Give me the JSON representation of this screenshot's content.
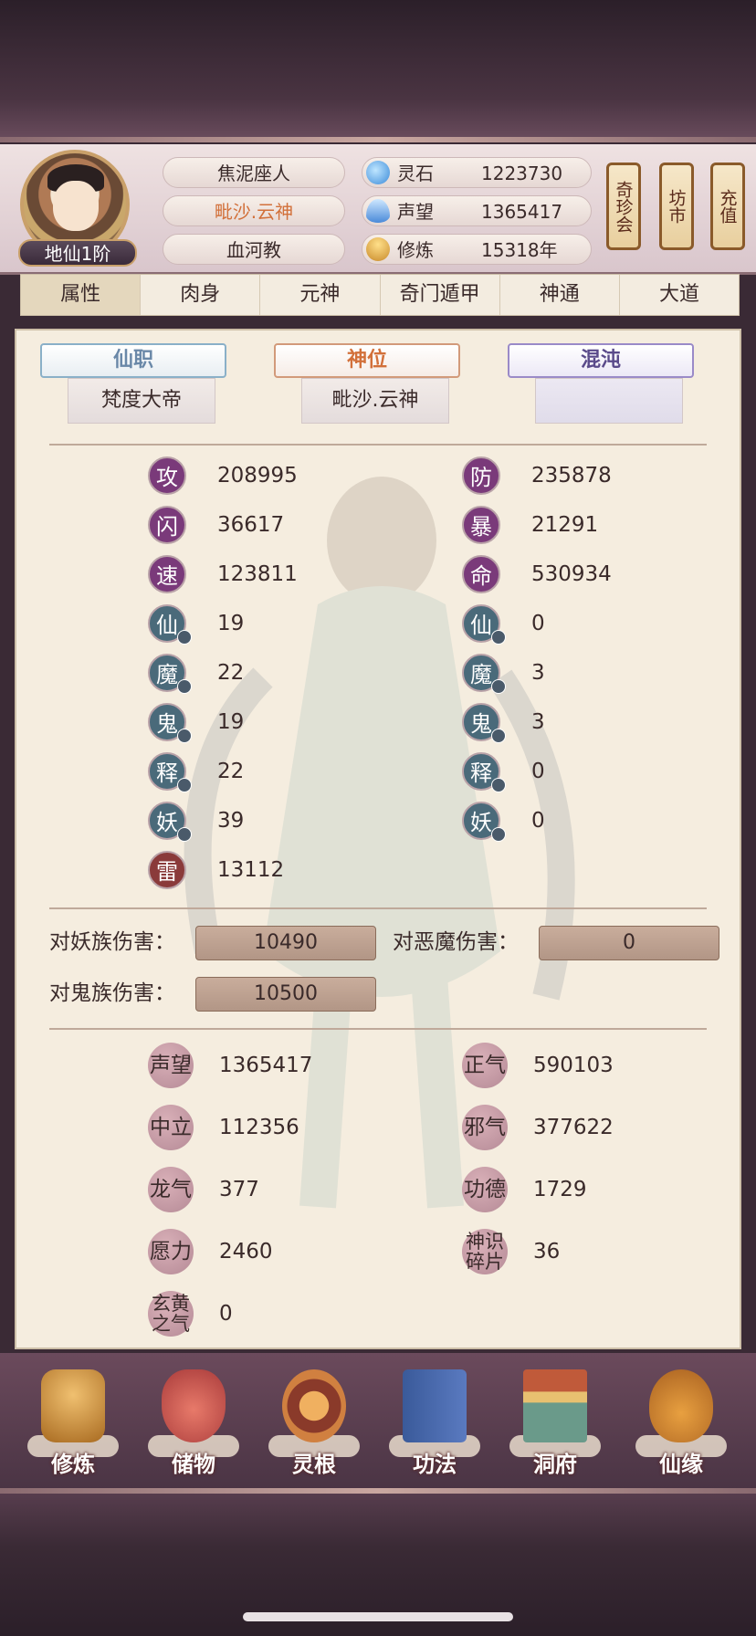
{
  "header": {
    "rank": "地仙1阶",
    "names": [
      "焦泥座人",
      "毗沙.云神",
      "血河教"
    ],
    "resources": [
      {
        "icon": "spirit-stone-icon",
        "label": "灵石",
        "value": "1223730"
      },
      {
        "icon": "reputation-icon",
        "label": "声望",
        "value": "1365417"
      },
      {
        "icon": "cultivation-icon",
        "label": "修炼",
        "value": "15318年"
      }
    ],
    "scrolls": [
      "奇珍会",
      "坊市",
      "充值"
    ]
  },
  "tabs": [
    "属性",
    "肉身",
    "元神",
    "奇门遁甲",
    "神通",
    "大道"
  ],
  "titles": [
    {
      "banner": "仙职",
      "value": "梵度大帝",
      "color": "#6a88a8"
    },
    {
      "banner": "神位",
      "value": "毗沙.云神",
      "color": "#d2703a"
    },
    {
      "banner": "混沌",
      "value": "",
      "color": "#5a4a8a"
    }
  ],
  "stats_left": [
    {
      "char": "攻",
      "value": "208995"
    },
    {
      "char": "闪",
      "value": "36617"
    },
    {
      "char": "速",
      "value": "123811"
    },
    {
      "char": "仙",
      "value": "19"
    },
    {
      "char": "魔",
      "value": "22"
    },
    {
      "char": "鬼",
      "value": "19"
    },
    {
      "char": "释",
      "value": "22"
    },
    {
      "char": "妖",
      "value": "39"
    },
    {
      "char": "雷",
      "value": "13112"
    }
  ],
  "stats_right": [
    {
      "char": "防",
      "value": "235878"
    },
    {
      "char": "暴",
      "value": "21291"
    },
    {
      "char": "命",
      "value": "530934"
    },
    {
      "char": "仙",
      "value": "0"
    },
    {
      "char": "魔",
      "value": "3"
    },
    {
      "char": "鬼",
      "value": "3"
    },
    {
      "char": "释",
      "value": "0"
    },
    {
      "char": "妖",
      "value": "0"
    }
  ],
  "damage": {
    "vs_demon_race_label": "对妖族伤害：",
    "vs_demon_race_value": "10490",
    "vs_evil_label": "对恶魔伤害：",
    "vs_evil_value": "0",
    "vs_ghost_label": "对鬼族伤害：",
    "vs_ghost_value": "10500"
  },
  "reputation_left": [
    {
      "label": "声望",
      "value": "1365417"
    },
    {
      "label": "中立",
      "value": "112356"
    },
    {
      "label": "龙气",
      "value": "377"
    },
    {
      "label": "愿力",
      "value": "2460"
    },
    {
      "label": "玄黄之气",
      "value": "0"
    }
  ],
  "reputation_right": [
    {
      "label": "正气",
      "value": "590103"
    },
    {
      "label": "邪气",
      "value": "377622"
    },
    {
      "label": "功德",
      "value": "1729"
    },
    {
      "label": "神识碎片",
      "value": "36"
    }
  ],
  "nav": [
    {
      "icon": "monk-icon",
      "label": "修炼"
    },
    {
      "icon": "storage-bag-icon",
      "label": "储物"
    },
    {
      "icon": "spirit-root-icon",
      "label": "灵根"
    },
    {
      "icon": "book-icon",
      "label": "功法"
    },
    {
      "icon": "cave-palace-icon",
      "label": "洞府"
    },
    {
      "icon": "gourd-icon",
      "label": "仙缘"
    }
  ]
}
